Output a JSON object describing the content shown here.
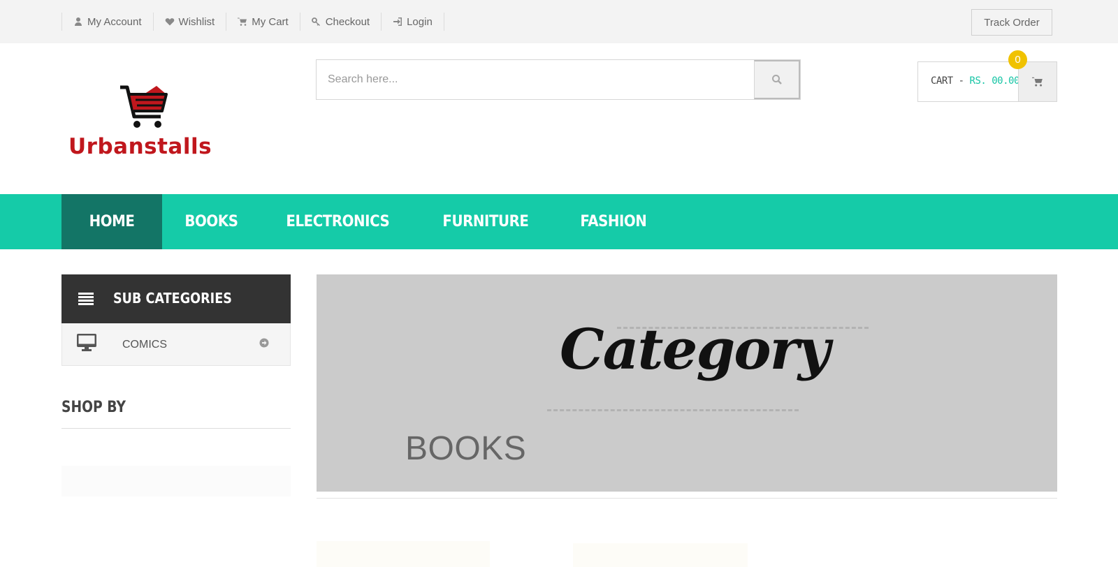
{
  "topbar": {
    "links": [
      {
        "label": "My Account",
        "icon": "user-icon"
      },
      {
        "label": "Wishlist",
        "icon": "heart-icon"
      },
      {
        "label": "My Cart",
        "icon": "cart-icon"
      },
      {
        "label": "Checkout",
        "icon": "key-icon"
      },
      {
        "label": "Login",
        "icon": "sign-in-icon"
      }
    ],
    "track_order": "Track Order"
  },
  "header": {
    "logo_text": "Urbanstalls",
    "search_placeholder": "Search here...",
    "cart_label": "CART - ",
    "cart_amount": "RS. 00.00",
    "cart_count": "0"
  },
  "nav": {
    "items": [
      "HOME",
      "BOOKS",
      "ELECTRONICS",
      "FURNITURE",
      "FASHION"
    ],
    "active": "HOME"
  },
  "sidebar": {
    "subcategories_title": "SUB CATEGORIES",
    "subcategories": [
      {
        "label": "COMICS",
        "icon": "desktop-icon"
      }
    ],
    "shop_by_title": "SHOP BY"
  },
  "banner": {
    "word": "Category",
    "title": "BOOKS"
  },
  "colors": {
    "accent": "#15cba8",
    "nav_active": "#137566",
    "brand_red": "#c0171d",
    "badge": "#f0c200",
    "dark_header": "#333333"
  }
}
